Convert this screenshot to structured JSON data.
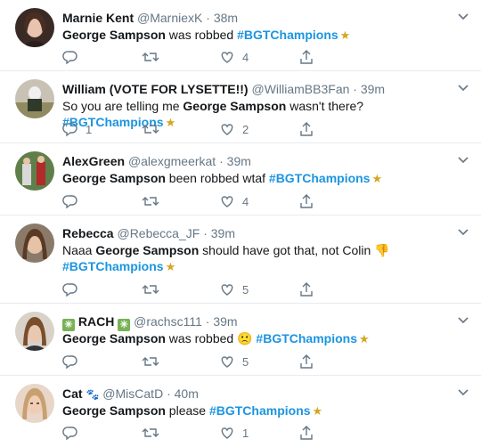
{
  "tweets": [
    {
      "name": "Marnie Kent",
      "handle": "@MarniexK",
      "sep": "·",
      "time": "38m",
      "text": [
        {
          "t": "George Sampson",
          "k": "bold"
        },
        {
          "t": " was robbed ",
          "k": "plain"
        },
        {
          "t": "#BGTChampions",
          "k": "tag"
        },
        {
          "t": "★",
          "k": "star"
        }
      ],
      "reply_count": "",
      "retweet_count": "",
      "like_count": "4"
    },
    {
      "name": "William (VOTE FOR LYSETTE!!)",
      "handle": "@WilliamBB3Fan",
      "sep": "·",
      "time": "39m",
      "text": [
        {
          "t": "So you are telling me ",
          "k": "plain"
        },
        {
          "t": "George Sampson",
          "k": "bold"
        },
        {
          "t": " wasn't there? ",
          "k": "plain"
        },
        {
          "t": "#BGTChampions",
          "k": "tag"
        },
        {
          "t": "★",
          "k": "star"
        }
      ],
      "reply_count": "1",
      "retweet_count": "",
      "like_count": "2"
    },
    {
      "name": "AlexGreen",
      "handle": "@alexgmeerkat",
      "sep": "·",
      "time": "39m",
      "text": [
        {
          "t": "George Sampson",
          "k": "bold"
        },
        {
          "t": " been robbed wtaf ",
          "k": "plain"
        },
        {
          "t": "#BGTChampions",
          "k": "tag"
        },
        {
          "t": "★",
          "k": "star"
        }
      ],
      "reply_count": "",
      "retweet_count": "",
      "like_count": "4"
    },
    {
      "name": "Rebecca",
      "handle": "@Rebecca_JF",
      "sep": "·",
      "time": "39m",
      "text": [
        {
          "t": "Naaa ",
          "k": "plain"
        },
        {
          "t": "George Sampson",
          "k": "bold"
        },
        {
          "t": " should have got that, not Colin ",
          "k": "plain"
        },
        {
          "t": "👎",
          "k": "plain"
        },
        {
          "t": " ",
          "k": "plain"
        },
        {
          "t": "#BGTChampions",
          "k": "tag"
        },
        {
          "t": "★",
          "k": "star"
        }
      ],
      "reply_count": "",
      "retweet_count": "",
      "like_count": "5"
    },
    {
      "name": "RACH",
      "handle": "@rachsc111",
      "sep": "·",
      "time": "39m",
      "name_emoji": "✳",
      "text": [
        {
          "t": "George Sampson",
          "k": "bold"
        },
        {
          "t": " was robbed ",
          "k": "plain"
        },
        {
          "t": "🙁",
          "k": "plain"
        },
        {
          "t": " ",
          "k": "plain"
        },
        {
          "t": "#BGTChampions",
          "k": "tag"
        },
        {
          "t": "★",
          "k": "star"
        }
      ],
      "reply_count": "",
      "retweet_count": "",
      "like_count": "5"
    },
    {
      "name": "Cat",
      "handle": "@MisCatD",
      "sep": "·",
      "time": "40m",
      "name_emoji": "🐾",
      "text": [
        {
          "t": "George Sampson",
          "k": "bold"
        },
        {
          "t": " please ",
          "k": "plain"
        },
        {
          "t": "#BGTChampions",
          "k": "tag"
        },
        {
          "t": "★",
          "k": "star"
        }
      ],
      "reply_count": "",
      "retweet_count": "",
      "like_count": "1"
    }
  ],
  "colors": {
    "hashtag": "#1b95e0",
    "meta": "#657786",
    "divider": "#e6ecf0",
    "text": "#14171a"
  },
  "icons": [
    "reply-icon",
    "retweet-icon",
    "like-icon",
    "share-icon",
    "caret-down-icon"
  ]
}
